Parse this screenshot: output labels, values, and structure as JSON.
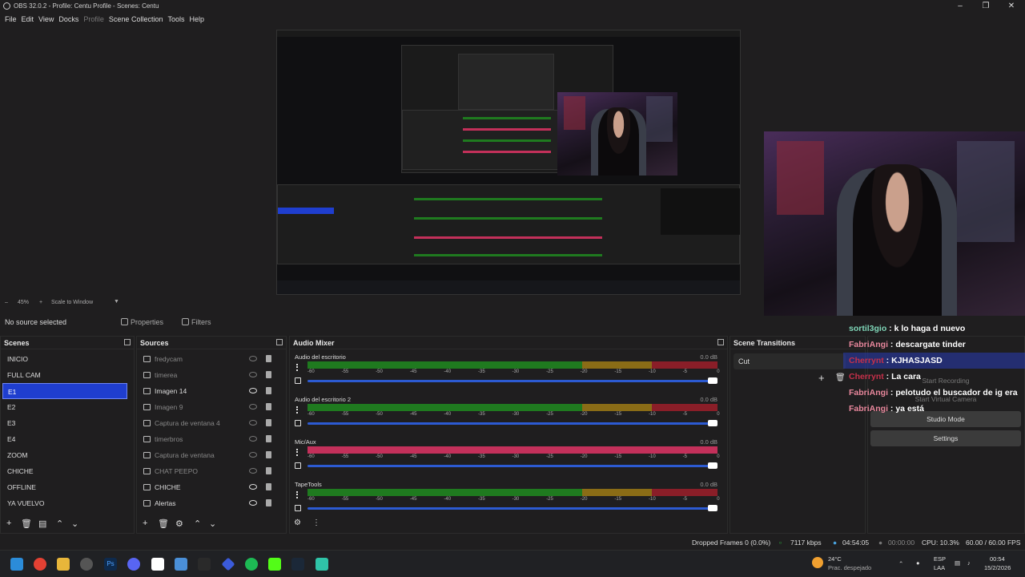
{
  "window": {
    "title": "OBS 32.0.2 - Profile: Centu Profile - Scenes: Centu"
  },
  "menu": [
    "File",
    "Edit",
    "View",
    "Docks",
    "Profile",
    "Scene Collection",
    "Tools",
    "Help"
  ],
  "scale": {
    "zoom": "45%",
    "mode": "Scale to Window"
  },
  "source_toolbar": {
    "selected": "No source selected",
    "properties": "Properties",
    "filters": "Filters"
  },
  "scenes": {
    "title": "Scenes",
    "items": [
      "INICIO",
      "FULL CAM",
      "E1",
      "E2",
      "E3",
      "E4",
      "ZOOM",
      "CHICHE",
      "OFFLINE",
      "YA VUELVO"
    ],
    "selected_index": 2
  },
  "sources": {
    "title": "Sources",
    "items": [
      {
        "name": "fredycam",
        "visible": false
      },
      {
        "name": "timerea",
        "visible": false
      },
      {
        "name": "Imagen 14",
        "visible": true
      },
      {
        "name": "Imagen 9",
        "visible": false
      },
      {
        "name": "Captura de ventana 4",
        "visible": false
      },
      {
        "name": "timerbros",
        "visible": false
      },
      {
        "name": "Captura de ventana",
        "visible": false
      },
      {
        "name": "CHAT PEEPO",
        "visible": false
      },
      {
        "name": "CHICHE",
        "visible": true
      },
      {
        "name": "Alertas",
        "visible": true
      }
    ]
  },
  "mixer": {
    "title": "Audio Mixer",
    "scale_labels": [
      "-60",
      "-55",
      "-50",
      "-45",
      "-40",
      "-35",
      "-30",
      "-25",
      "-20",
      "-15",
      "-10",
      "-5",
      "0"
    ],
    "tracks": [
      {
        "name": "Audio del escritorio",
        "db": "0.0 dB",
        "hot": false
      },
      {
        "name": "Audio del escritorio 2",
        "db": "0.0 dB",
        "hot": false
      },
      {
        "name": "Mic/Aux",
        "db": "0.0 dB",
        "hot": true
      },
      {
        "name": "TapeTools",
        "db": "0.0 dB",
        "hot": false
      }
    ]
  },
  "transitions": {
    "title": "Scene Transitions",
    "selected": "Cut"
  },
  "controls": {
    "recording": "Start Recording",
    "virtual_camera": "Start Virtual Camera",
    "studio_mode": "Studio Mode",
    "settings": "Settings"
  },
  "chat": [
    {
      "user": "sortil3gio",
      "msg": "k lo haga d nuevo",
      "color": "#7fd6b8"
    },
    {
      "user": "FabriAngi",
      "msg": "descargate tinder",
      "color": "#e8879c"
    },
    {
      "user": "Cherrynt",
      "msg": "KJHASJASD",
      "color": "#c6304a",
      "highlight": true
    },
    {
      "user": "Cherrynt",
      "msg": "La cara",
      "color": "#c6304a"
    },
    {
      "user": "FabriAngi",
      "msg": "pelotudo el buscador de ig era",
      "color": "#e8879c"
    },
    {
      "user": "FabriAngi",
      "msg": "ya está",
      "color": "#e8879c"
    }
  ],
  "status": {
    "dropped": "Dropped Frames 0 (0.0%)",
    "bitrate": "7117 kbps",
    "stream_time": "04:54:05",
    "rec_time": "00:00:00",
    "cpu": "CPU: 10.3%",
    "fps": "60.00 / 60.00 FPS"
  },
  "taskbar": {
    "weather_temp": "24°C",
    "weather_desc": "Prac. despejado",
    "lang1": "ESP",
    "lang2": "LAA",
    "time": "00:54",
    "date": "15/2/2026"
  },
  "colors": {
    "accent": "#1f3ecf",
    "meter_green": "#1f7a1f",
    "meter_yellow": "#8a6c16",
    "meter_red": "#8a1e28",
    "meter_hot": "#c3305a"
  }
}
